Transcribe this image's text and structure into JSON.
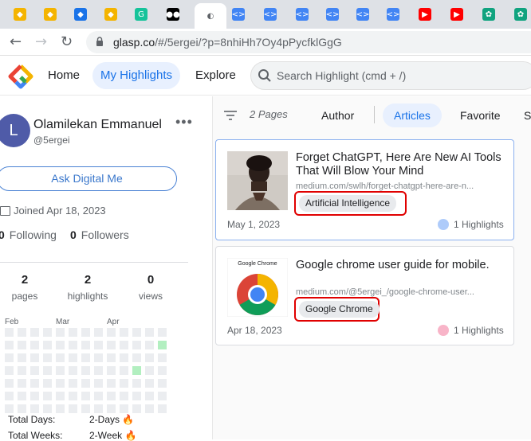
{
  "browser": {
    "url_host": "glasp.co",
    "url_path": "/#/5ergei/?p=8nhiHh7Oy4pPycfklGgG",
    "tabs": [
      {
        "icon": "glasp-icon",
        "color": "#f4b400"
      },
      {
        "icon": "glasp-icon",
        "color": "#f4b400"
      },
      {
        "icon": "blue-diamond-icon",
        "color": "#1a73e8"
      },
      {
        "icon": "glasp-icon",
        "color": "#f4b400"
      },
      {
        "icon": "grammarly-icon",
        "color": "#15c39a"
      },
      {
        "icon": "medium-icon",
        "color": "#000000"
      },
      {
        "icon": "loading-icon",
        "color": "#5f6368"
      },
      {
        "icon": "code-icon",
        "color": "#4285f4"
      },
      {
        "icon": "code-icon",
        "color": "#4285f4"
      },
      {
        "icon": "code-icon",
        "color": "#4285f4"
      },
      {
        "icon": "code-icon",
        "color": "#4285f4"
      },
      {
        "icon": "code-icon",
        "color": "#4285f4"
      },
      {
        "icon": "code-icon",
        "color": "#4285f4"
      },
      {
        "icon": "youtube-icon",
        "color": "#ff0000"
      },
      {
        "icon": "youtube-icon",
        "color": "#ff0000"
      },
      {
        "icon": "chatgpt-icon",
        "color": "#10a37f"
      },
      {
        "icon": "chatgpt-icon",
        "color": "#10a37f"
      }
    ]
  },
  "header": {
    "home": "Home",
    "my_highlights": "My Highlights",
    "explore": "Explore",
    "search_placeholder": "Search Highlight (cmd + /)"
  },
  "profile": {
    "avatar_letter": "L",
    "name": "Olamilekan Emmanuel",
    "handle": "@5ergei",
    "ask_button": "Ask Digital Me",
    "joined": "Joined Apr 18, 2023",
    "following_count": "0",
    "following_label": "Following",
    "followers_count": "0",
    "followers_label": "Followers",
    "stats": [
      {
        "num": "2",
        "label": "pages"
      },
      {
        "num": "2",
        "label": "highlights"
      },
      {
        "num": "0",
        "label": "views"
      }
    ],
    "months": [
      "Feb",
      "Mar",
      "Apr"
    ],
    "total_days_label": "Total Days:",
    "total_days_value": "2-Days 🔥",
    "total_weeks_label": "Total Weeks:",
    "total_weeks_value": "2-Week 🔥"
  },
  "filters": {
    "pages": "2 Pages",
    "author": "Author",
    "articles": "Articles",
    "favorite": "Favorite",
    "cut": "S"
  },
  "cards": [
    {
      "title": "Forget ChatGPT, Here Are New AI Tools That Will Blow Your Mind",
      "url": "medium.com/swlh/forget-chatgpt-here-are-n...",
      "tag": "Artificial Intelligence",
      "date": "May 1, 2023",
      "highlights": "1 Highlights",
      "dot_color": "#aecbfa"
    },
    {
      "title": "Google chrome user guide for mobile.",
      "url": "medium.com/@5ergei_/google-chrome-user...",
      "tag": "Google Chrome",
      "date": "Apr 18, 2023",
      "highlights": "1 Highlights",
      "dot_color": "#f8b4c8",
      "thumb_caption": "Google Chrome"
    }
  ]
}
